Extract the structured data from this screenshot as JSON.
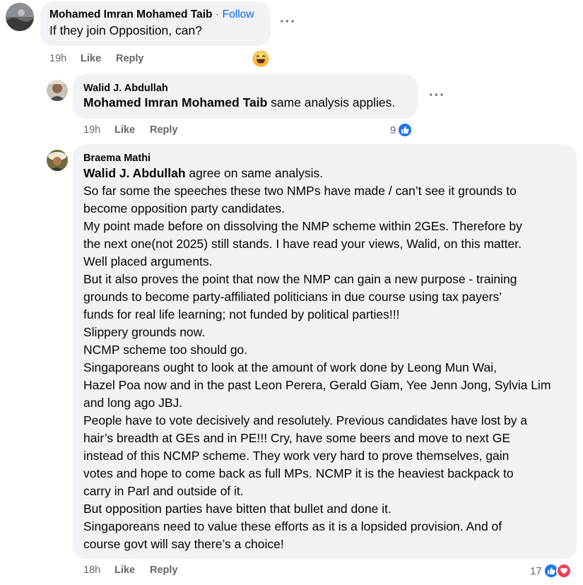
{
  "comment1": {
    "author": "Mohamed Imran Mohamed Taib",
    "separator": "·",
    "follow": "Follow",
    "text": "If they join Opposition, can?",
    "time": "19h",
    "like": "Like",
    "reply": "Reply",
    "more": "···",
    "reaction_icon": "laughing-emoji"
  },
  "comment2": {
    "author": "Walid J. Abdullah",
    "mention": "Mohamed Imran Mohamed Taib",
    "text": " same analysis applies.",
    "time": "19h",
    "like": "Like",
    "reply": "Reply",
    "more": "···",
    "reaction_count": "9",
    "reaction_icon": "like-icon"
  },
  "comment3": {
    "author": "Braema Mathi",
    "mention": "Walid J. Abdullah",
    "lines": [
      " agree on same analysis.",
      "So far some the speeches these two NMPs have made / can’t see it grounds to",
      "become opposition party candidates.",
      "My point made before on dissolving the NMP scheme within 2GEs. Therefore by",
      "the next one(not 2025) still stands. I have read your views, Walid, on this matter.",
      "Well placed arguments.",
      "But it also proves the point that now the NMP can gain a new purpose - training",
      "grounds to become party-affiliated politicians in due course using tax payers’",
      "funds for real life learning; not funded by political parties!!!",
      "Slippery grounds now.",
      "NCMP scheme too should go.",
      "Singaporeans ought to look at the amount of work done by Leong Mun Wai,",
      "Hazel Poa now and in the past Leon Perera, Gerald Giam, Yee Jenn Jong, Sylvia Lim",
      "and long ago JBJ.",
      "People have to vote decisively and resolutely. Previous candidates have lost by a",
      "hair’s breadth at GEs and in PE!!! Cry, have some beers and move to next GE",
      "instead of this NCMP scheme. They work very hard to prove themselves, gain",
      "votes and hope to come back as full MPs. NCMP it is the heaviest backpack to",
      "carry in Parl and outside of it.",
      "But opposition parties have bitten that bullet and done it.",
      "Singaporeans need to value these efforts as it is a lopsided provision. And of",
      "course govt will say there’s a choice!"
    ],
    "time": "18h",
    "like": "Like",
    "reply": "Reply",
    "reaction_count": "17",
    "reaction_icons": [
      "like-icon",
      "love-icon"
    ]
  },
  "colors": {
    "bubble": "#f0f2f5",
    "meta": "#65676b",
    "link": "#0866ff",
    "like": "#1877f2",
    "love": "#f33e58"
  }
}
